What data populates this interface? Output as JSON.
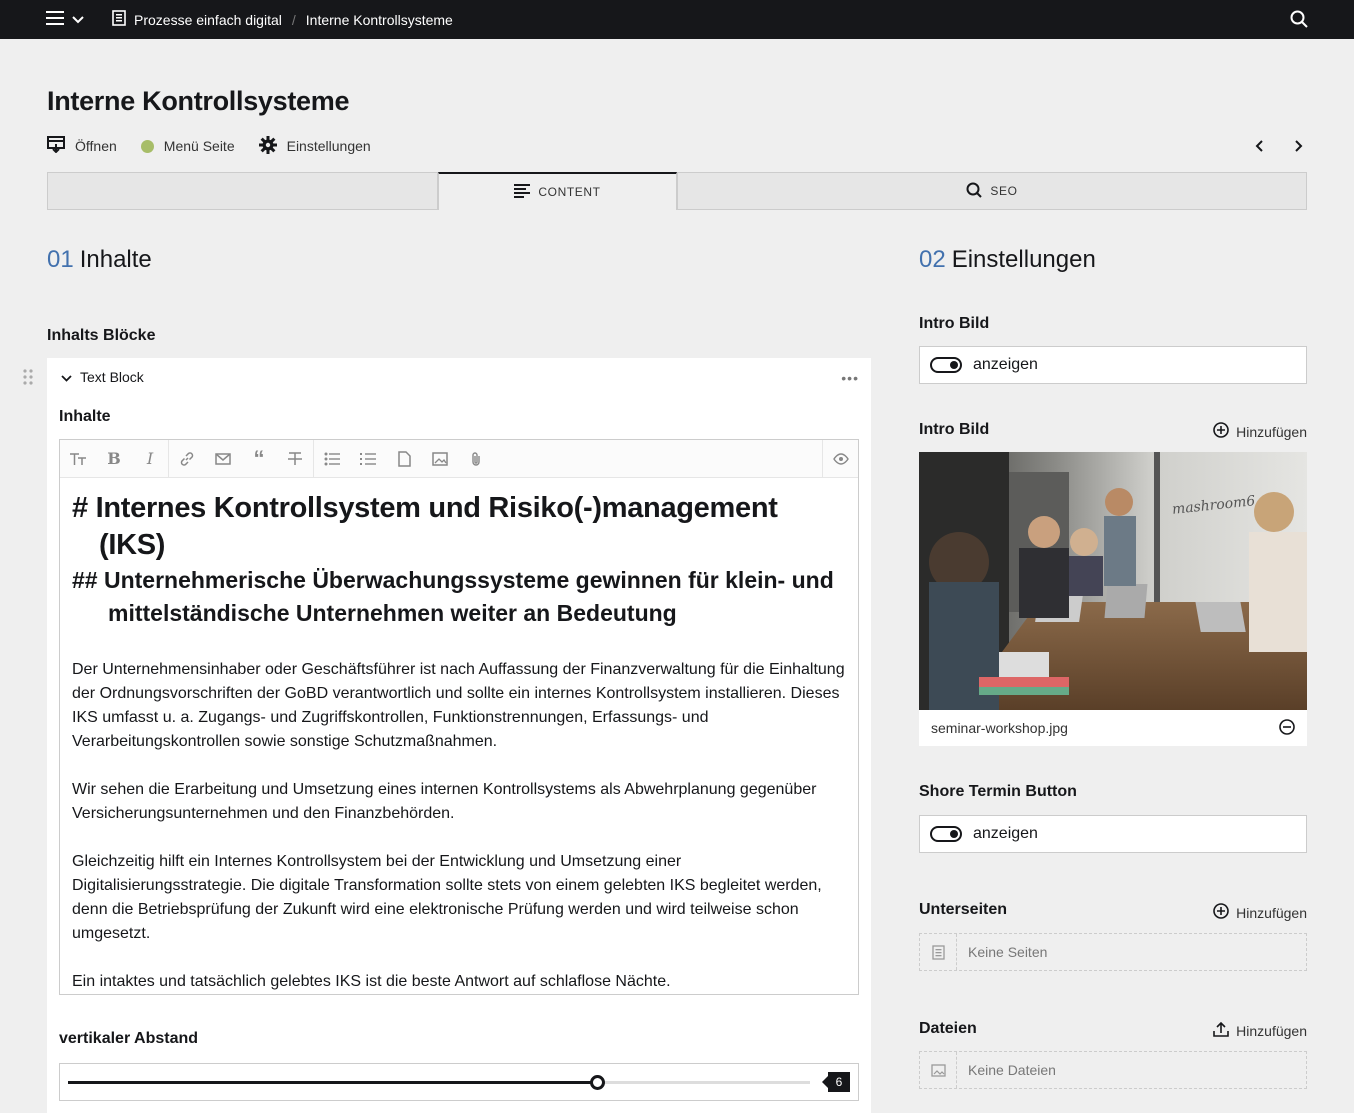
{
  "topbar": {
    "breadcrumbs": [
      "Prozesse einfach digital",
      "Interne Kontrollsysteme"
    ]
  },
  "page": {
    "title": "Interne Kontrollsysteme",
    "actions": {
      "open": "Öffnen",
      "status": "Menü Seite",
      "settings": "Einstellungen"
    }
  },
  "tabs": {
    "content": "CONTENT",
    "seo": "SEO"
  },
  "left": {
    "section_num": "01",
    "section_title": "Inhalte",
    "blocks_label": "Inhalts Blöcke",
    "block": {
      "type": "Text Block",
      "menu": "•••",
      "field_label": "Inhalte",
      "h1": "# Internes Kontrollsystem und Risiko(-)management (IKS)",
      "h2": "## Unternehmerische Überwachungssysteme gewinnen für klein- und mittelständische Unternehmen weiter an Bedeutung",
      "paragraphs": [
        "Der Unternehmensinhaber oder Geschäftsführer ist nach Auffassung der Finanzverwaltung für die Einhaltung der Ordnungsvorschriften der GoBD verantwortlich und sollte ein internes Kontrollsystem installieren. Dieses IKS umfasst u. a. Zugangs- und Zugriffskontrollen, Funktionstrennungen, Erfassungs- und Verarbeitungskontrollen sowie sonstige Schutzmaßnahmen.",
        "Wir sehen die Erarbeitung und Umsetzung eines internen Kontrollsystems als Abwehrplanung gegenüber Versicherungsunternehmen und den Finanzbehörden.",
        "Gleichzeitig hilft ein Internes Kontrollsystem bei der Entwicklung und Umsetzung einer Digitalisierungsstrategie. Die digitale Transformation sollte stets von einem gelebten IKS begleitet werden, denn die Betriebsprüfung der Zukunft wird eine elektronische Prüfung werden und wird teilweise schon umgesetzt.",
        "Ein intaktes und tatsächlich gelebtes IKS ist die beste Antwort auf schlaflose Nächte."
      ],
      "spacing_label": "vertikaler Abstand",
      "spacing_value": "6",
      "spacing_fraction": 0.713
    }
  },
  "right": {
    "section_num": "02",
    "section_title": "Einstellungen",
    "intro_toggle_label": "Intro Bild",
    "intro_toggle_text": "anzeigen",
    "intro_image_label": "Intro Bild",
    "add_label": "Hinzufügen",
    "image_filename": "seminar-workshop.jpg",
    "image_wall_text": "mashroom6",
    "termin_label": "Shore Termin Button",
    "termin_toggle_text": "anzeigen",
    "subpages_label": "Unterseiten",
    "subpages_empty": "Keine Seiten",
    "files_label": "Dateien",
    "files_empty": "Keine Dateien"
  },
  "colors": {
    "accent": "#4271ae",
    "status_green": "#a7bd68",
    "topbar": "#16171a",
    "background": "#efefef"
  }
}
